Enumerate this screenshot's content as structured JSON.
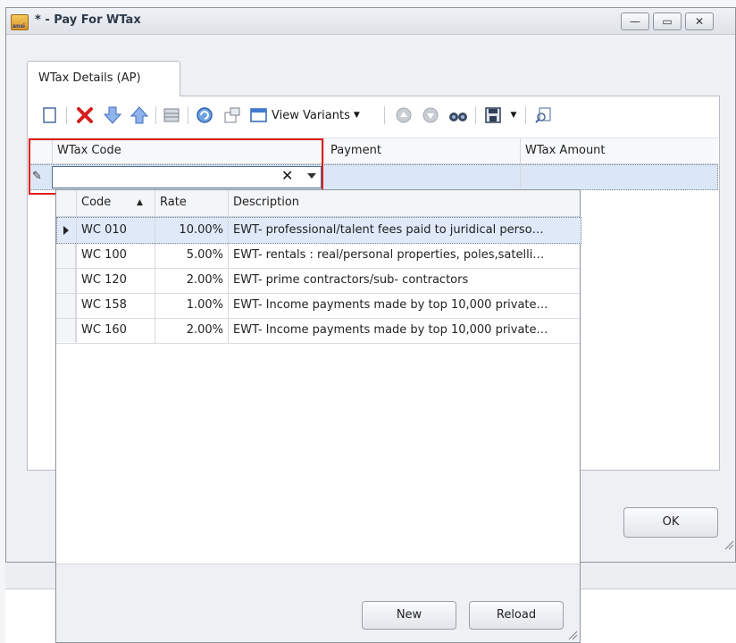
{
  "window": {
    "title": "* - Pay For WTax",
    "app_icon_text": "ansi"
  },
  "tabs": [
    {
      "label": "WTax Details (AP)"
    }
  ],
  "toolbar": {
    "view_variants_label": "View Variants"
  },
  "grid": {
    "columns": [
      "WTax Code",
      "Payment",
      "WTax Amount"
    ],
    "edit_row": {
      "wtax_code": "",
      "payment": "",
      "wtax_amount": ""
    }
  },
  "lookup": {
    "columns": [
      "Code",
      "Rate",
      "Description"
    ],
    "sort": {
      "column": "Code",
      "direction": "ascending"
    },
    "rows": [
      {
        "code": "WC 010",
        "rate": "10.00%",
        "description": "EWT- professional/talent fees paid to juridical perso…",
        "selected": true
      },
      {
        "code": "WC 100",
        "rate": "5.00%",
        "description": "EWT- rentals : real/personal properties, poles,satelli…",
        "selected": false
      },
      {
        "code": "WC 120",
        "rate": "2.00%",
        "description": "EWT- prime contractors/sub- contractors",
        "selected": false
      },
      {
        "code": "WC 158",
        "rate": "1.00%",
        "description": "EWT- Income payments made by top 10,000 private…",
        "selected": false
      },
      {
        "code": "WC 160",
        "rate": "2.00%",
        "description": "EWT- Income payments made by top 10,000 private…",
        "selected": false
      }
    ],
    "new_label": "New",
    "reload_label": "Reload"
  },
  "dialog": {
    "ok_label": "OK"
  },
  "colors": {
    "highlight": "#e11b1b",
    "selected_row": "#dfe9f8",
    "edit_row": "#dbe7f7"
  }
}
